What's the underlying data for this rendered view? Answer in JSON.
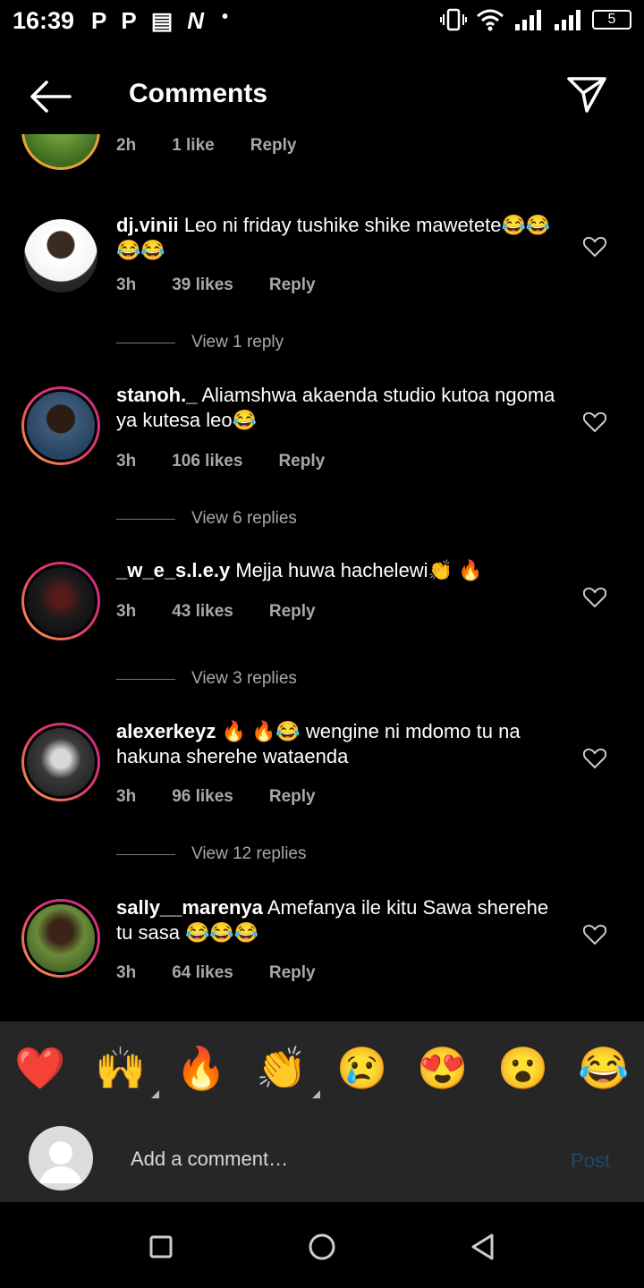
{
  "status_bar": {
    "time": "16:39",
    "apps": [
      "P",
      "P",
      "▤",
      "N"
    ],
    "dot": "•",
    "battery": "5"
  },
  "header": {
    "title": "Comments"
  },
  "partial_comment": {
    "time": "2h",
    "likes": "1 like",
    "reply": "Reply"
  },
  "comments": [
    {
      "username": "dj.vinii",
      "text": "Leo ni friday tushike shike mawetete😂😂😂😂",
      "time": "3h",
      "likes": "39 likes",
      "reply": "Reply",
      "view_replies": "View 1 reply"
    },
    {
      "username": "stanoh._",
      "text": "Aliamshwa akaenda studio kutoa ngoma ya kutesa leo😂",
      "time": "3h",
      "likes": "106 likes",
      "reply": "Reply",
      "view_replies": "View 6 replies"
    },
    {
      "username": "_w_e_s.l.e.y",
      "text": "Mejja huwa hachelewi👏 🔥",
      "time": "3h",
      "likes": "43 likes",
      "reply": "Reply",
      "view_replies": "View 3 replies"
    },
    {
      "username": "alexerkeyz",
      "text": "🔥 🔥😂 wengine ni mdomo tu na hakuna sherehe wataenda",
      "time": "3h",
      "likes": "96 likes",
      "reply": "Reply",
      "view_replies": "View 12 replies"
    },
    {
      "username": "sally__marenya",
      "text": "Amefanya ile kitu Sawa sherehe tu sasa 😂😂😂",
      "time": "3h",
      "likes": "64 likes",
      "reply": "Reply"
    }
  ],
  "reactions": [
    "❤️",
    "🙌",
    "🔥",
    "👏",
    "😢",
    "😍",
    "😮",
    "😂"
  ],
  "composer": {
    "placeholder": "Add a comment…",
    "post_label": "Post"
  },
  "colors": {
    "background": "#000000",
    "bar": "#262626",
    "muted": "#a8a8a8",
    "post": "#1c4a6e"
  }
}
